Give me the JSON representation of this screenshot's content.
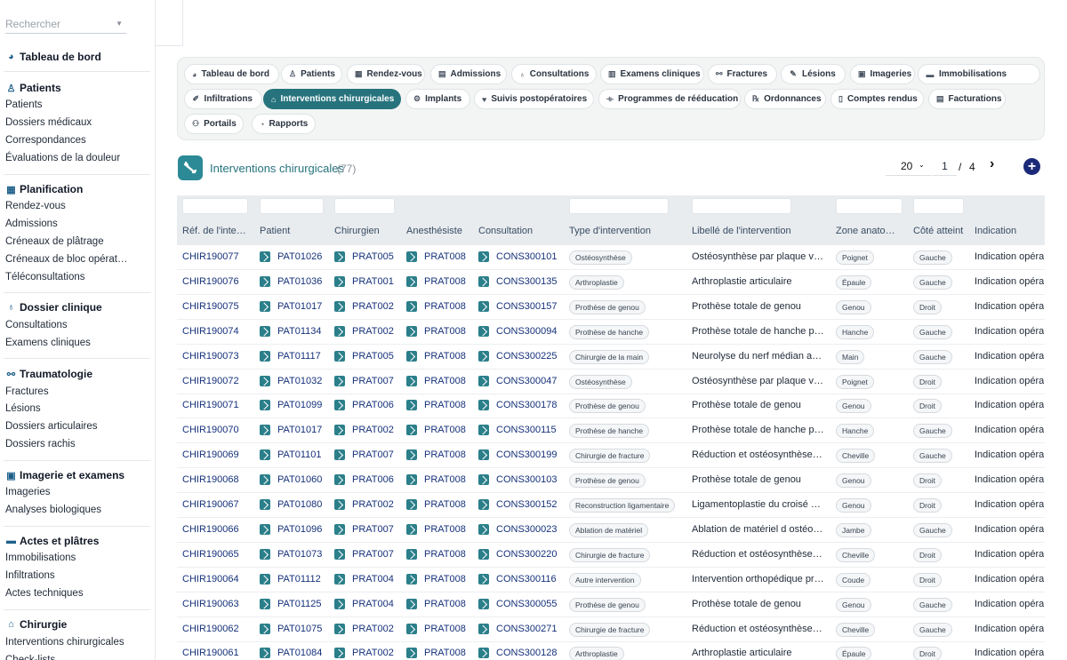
{
  "sidebar": {
    "search_placeholder": "Rechercher",
    "dashboard": "Tableau de bord",
    "sections": [
      {
        "title": "Patients",
        "icon": "person-icon",
        "items": [
          "Patients",
          "Dossiers médicaux",
          "Correspondances",
          "Évaluations de la douleur"
        ]
      },
      {
        "title": "Planification",
        "icon": "calendar-icon",
        "items": [
          "Rendez-vous",
          "Admissions",
          "Créneaux de plâtrage",
          "Créneaux de bloc opérat…",
          "Téléconsultations"
        ]
      },
      {
        "title": "Dossier clinique",
        "icon": "stethoscope-icon",
        "items": [
          "Consultations",
          "Examens cliniques"
        ]
      },
      {
        "title": "Traumatologie",
        "icon": "bone-icon",
        "items": [
          "Fractures",
          "Lésions",
          "Dossiers articulaires",
          "Dossiers rachis"
        ]
      },
      {
        "title": "Imagerie et examens",
        "icon": "xray-icon",
        "items": [
          "Imageries",
          "Analyses biologiques"
        ]
      },
      {
        "title": "Actes et plâtres",
        "icon": "splint-icon",
        "items": [
          "Immobilisations",
          "Infiltrations",
          "Actes techniques"
        ]
      },
      {
        "title": "Chirurgie",
        "icon": "bed-icon",
        "items": [
          "Interventions chirurgicales",
          "Check-lists"
        ]
      }
    ]
  },
  "tabs": [
    {
      "label": "Tableau de bord",
      "icon": "dashboard-icon",
      "active": false
    },
    {
      "label": "Patients",
      "icon": "person-icon",
      "active": false
    },
    {
      "label": "Rendez-vous",
      "icon": "calendar-icon",
      "active": false
    },
    {
      "label": "Admissions",
      "icon": "clipboard-icon",
      "active": false
    },
    {
      "label": "Consultations",
      "icon": "stethoscope-icon",
      "active": false
    },
    {
      "label": "Examens cliniques",
      "icon": "exam-icon",
      "active": false
    },
    {
      "label": "Fractures",
      "icon": "bone-icon",
      "active": false
    },
    {
      "label": "Lésions",
      "icon": "bandage-icon",
      "active": false
    },
    {
      "label": "Imageries",
      "icon": "xray-icon",
      "active": false
    },
    {
      "label": "Immobilisations",
      "icon": "splint-icon",
      "active": false
    },
    {
      "label": "Infiltrations",
      "icon": "syringe-icon",
      "active": false
    },
    {
      "label": "Interventions chirurgicales",
      "icon": "bed-icon",
      "active": true
    },
    {
      "label": "Implants",
      "icon": "gears-icon",
      "active": false
    },
    {
      "label": "Suivis postopératoires",
      "icon": "heart-icon",
      "active": false
    },
    {
      "label": "Programmes de rééducation",
      "icon": "dumbbell-icon",
      "active": false
    },
    {
      "label": "Ordonnances",
      "icon": "prescription-icon",
      "active": false
    },
    {
      "label": "Comptes rendus",
      "icon": "file-icon",
      "active": false
    },
    {
      "label": "Facturations",
      "icon": "invoice-icon",
      "active": false
    },
    {
      "label": "Portails",
      "icon": "users-icon",
      "active": false
    },
    {
      "label": "Rapports",
      "icon": "pie-chart-icon",
      "active": false
    }
  ],
  "list": {
    "title": "Interventions chirurgicales",
    "count": "(77)",
    "page_size": "20",
    "page": "1",
    "page_sep": "/",
    "total_pages": "4"
  },
  "columns": [
    "Réf. de l'inte…",
    "Patient",
    "Chirurgien",
    "Anesthésiste",
    "Consultation",
    "Type d'intervention",
    "Libellé de l'intervention",
    "Zone anato…",
    "Côté atteint",
    "Indication"
  ],
  "rows": [
    {
      "ref": "CHIR190077",
      "patient": "PAT01026",
      "surgeon": "PRAT005",
      "anesth": "PRAT008",
      "consult": "CONS300101",
      "type": "Ostéosynthèse",
      "label": "Ostéosynthèse par plaque v…",
      "zone": "Poignet",
      "side": "Gauche",
      "indication": "Indication opéra"
    },
    {
      "ref": "CHIR190076",
      "patient": "PAT01036",
      "surgeon": "PRAT001",
      "anesth": "PRAT008",
      "consult": "CONS300135",
      "type": "Arthroplastie",
      "label": "Arthroplastie articulaire",
      "zone": "Épaule",
      "side": "Gauche",
      "indication": "Indication opéra"
    },
    {
      "ref": "CHIR190075",
      "patient": "PAT01017",
      "surgeon": "PRAT002",
      "anesth": "PRAT008",
      "consult": "CONS300157",
      "type": "Prothèse de genou",
      "label": "Prothèse totale de genou",
      "zone": "Genou",
      "side": "Droit",
      "indication": "Indication opéra"
    },
    {
      "ref": "CHIR190074",
      "patient": "PAT01134",
      "surgeon": "PRAT002",
      "anesth": "PRAT008",
      "consult": "CONS300094",
      "type": "Prothèse de hanche",
      "label": "Prothèse totale de hanche p…",
      "zone": "Hanche",
      "side": "Gauche",
      "indication": "Indication opéra"
    },
    {
      "ref": "CHIR190073",
      "patient": "PAT01117",
      "surgeon": "PRAT005",
      "anesth": "PRAT008",
      "consult": "CONS300225",
      "type": "Chirurgie de la main",
      "label": "Neurolyse du nerf médian a…",
      "zone": "Main",
      "side": "Gauche",
      "indication": "Indication opéra"
    },
    {
      "ref": "CHIR190072",
      "patient": "PAT01032",
      "surgeon": "PRAT007",
      "anesth": "PRAT008",
      "consult": "CONS300047",
      "type": "Ostéosynthèse",
      "label": "Ostéosynthèse par plaque v…",
      "zone": "Poignet",
      "side": "Droit",
      "indication": "Indication opéra"
    },
    {
      "ref": "CHIR190071",
      "patient": "PAT01099",
      "surgeon": "PRAT006",
      "anesth": "PRAT008",
      "consult": "CONS300178",
      "type": "Prothèse de genou",
      "label": "Prothèse totale de genou",
      "zone": "Genou",
      "side": "Droit",
      "indication": "Indication opéra"
    },
    {
      "ref": "CHIR190070",
      "patient": "PAT01017",
      "surgeon": "PRAT002",
      "anesth": "PRAT008",
      "consult": "CONS300115",
      "type": "Prothèse de hanche",
      "label": "Prothèse totale de hanche p…",
      "zone": "Hanche",
      "side": "Gauche",
      "indication": "Indication opéra"
    },
    {
      "ref": "CHIR190069",
      "patient": "PAT01101",
      "surgeon": "PRAT007",
      "anesth": "PRAT008",
      "consult": "CONS300199",
      "type": "Chirurgie de fracture",
      "label": "Réduction et ostéosynthèse…",
      "zone": "Cheville",
      "side": "Gauche",
      "indication": "Indication opéra"
    },
    {
      "ref": "CHIR190068",
      "patient": "PAT01060",
      "surgeon": "PRAT006",
      "anesth": "PRAT008",
      "consult": "CONS300103",
      "type": "Prothèse de genou",
      "label": "Prothèse totale de genou",
      "zone": "Genou",
      "side": "Droit",
      "indication": "Indication opéra"
    },
    {
      "ref": "CHIR190067",
      "patient": "PAT01080",
      "surgeon": "PRAT002",
      "anesth": "PRAT008",
      "consult": "CONS300152",
      "type": "Reconstruction ligamentaire",
      "label": "Ligamentoplastie du croisé …",
      "zone": "Genou",
      "side": "Droit",
      "indication": "Indication opéra"
    },
    {
      "ref": "CHIR190066",
      "patient": "PAT01096",
      "surgeon": "PRAT007",
      "anesth": "PRAT008",
      "consult": "CONS300023",
      "type": "Ablation de matériel",
      "label": "Ablation de matériel d ostéo…",
      "zone": "Jambe",
      "side": "Gauche",
      "indication": "Indication opéra"
    },
    {
      "ref": "CHIR190065",
      "patient": "PAT01073",
      "surgeon": "PRAT007",
      "anesth": "PRAT008",
      "consult": "CONS300220",
      "type": "Chirurgie de fracture",
      "label": "Réduction et ostéosynthèse…",
      "zone": "Cheville",
      "side": "Droit",
      "indication": "Indication opéra"
    },
    {
      "ref": "CHIR190064",
      "patient": "PAT01112",
      "surgeon": "PRAT004",
      "anesth": "PRAT008",
      "consult": "CONS300116",
      "type": "Autre intervention",
      "label": "Intervention orthopédique pr…",
      "zone": "Coude",
      "side": "Droit",
      "indication": "Indication opéra"
    },
    {
      "ref": "CHIR190063",
      "patient": "PAT01125",
      "surgeon": "PRAT004",
      "anesth": "PRAT008",
      "consult": "CONS300055",
      "type": "Prothèse de genou",
      "label": "Prothèse totale de genou",
      "zone": "Genou",
      "side": "Gauche",
      "indication": "Indication opéra"
    },
    {
      "ref": "CHIR190062",
      "patient": "PAT01075",
      "surgeon": "PRAT002",
      "anesth": "PRAT008",
      "consult": "CONS300271",
      "type": "Chirurgie de fracture",
      "label": "Réduction et ostéosynthèse…",
      "zone": "Cheville",
      "side": "Gauche",
      "indication": "Indication opéra"
    },
    {
      "ref": "CHIR190061",
      "patient": "PAT01084",
      "surgeon": "PRAT002",
      "anesth": "PRAT008",
      "consult": "CONS300128",
      "type": "Arthroplastie",
      "label": "Arthroplastie articulaire",
      "zone": "Épaule",
      "side": "Droit",
      "indication": "Indication opéra"
    }
  ],
  "colors": {
    "accent": "#26737d",
    "link": "#15317a",
    "add_button": "#1b2a78"
  }
}
